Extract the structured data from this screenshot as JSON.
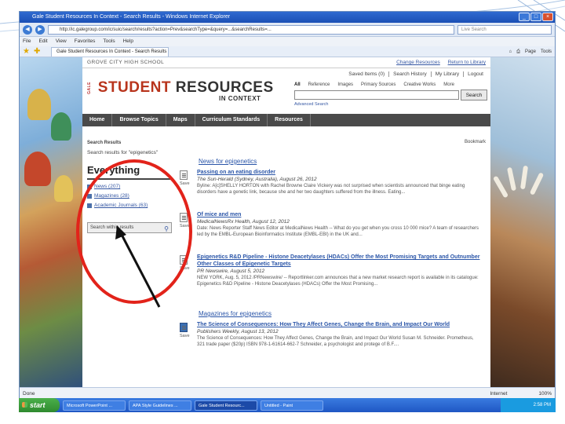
{
  "window": {
    "title": "Gale Student Resources In Context - Search Results - Windows Internet Explorer",
    "url": "http://ic.galegroup.com/ic/suic/search/results?action=Prev&searchType=&query=...&searchResults=...",
    "search_placeholder": "Live Search",
    "menu": [
      "File",
      "Edit",
      "View",
      "Favorites",
      "Tools",
      "Help"
    ],
    "tab_title": "Gale Student Resources In Context - Search Results",
    "tools": [
      "Page",
      "Tools"
    ]
  },
  "site": {
    "school": "GROVE CITY HIGH SCHOOL",
    "links": [
      "Change Resources",
      "Return to Library"
    ],
    "top_links": [
      "Saved Items (0)",
      "Search History",
      "My Library",
      "Logout"
    ],
    "logo_gale": "GALE",
    "logo_student": "STUDENT",
    "logo_resources": "RESOURCES",
    "logo_context": "IN CONTEXT",
    "search_tabs": [
      "All",
      "Reference",
      "Images",
      "Primary Sources",
      "Creative Works",
      "More"
    ],
    "search_button": "Search",
    "advanced": "Advanced Search",
    "nav": [
      "Home",
      "Browse Topics",
      "Maps",
      "Curriculum Standards",
      "Resources"
    ]
  },
  "results": {
    "breadcrumb": "Search Results",
    "bookmark": "Bookmark",
    "results_for": "Search results for \"epigenetics\"",
    "facets": {
      "heading": "Everything",
      "items": [
        "News (207)",
        "Magazines (28)",
        "Academic Journals (63)"
      ],
      "within": "Search within results"
    },
    "news_heading": "News for epigenetics",
    "magazines_heading": "Magazines for epigenetics",
    "entries": [
      {
        "title": "Passing on an eating disorder",
        "source": "The Sun-Herald (Sydney, Australia), August 26, 2012",
        "snippet": "Byline: A[c]SHELLY HORTON with Rachel Browne Claire Vickery was not surprised when scientists announced that binge eating disorders have a genetic link, because she and her two daughters suffered from the illness. Eating..."
      },
      {
        "title": "Of mice and men",
        "source": "MedicalNewsRx Health, August 12, 2012",
        "snippet": "Date: News Reporter Staff News Editor at MedicalNews Health -- What do you get when you cross 10 000 mice? A team of researchers led by the EMBL-European Bioinformatics Institute (EMBL-EBI) in the UK and..."
      },
      {
        "title": "Epigenetics R&D Pipeline - Histone Deacetylases (HDACs) Offer the Most Promising Targets and Outnumber Other Classes of Epigenetic Targets",
        "source": "PR Newswire, August 5, 2012",
        "snippet": "NEW YORK, Aug. 5, 2012 /PRNewswire/ -- Reportlinker.com announces that a new market research report is available in its catalogue: Epigenetics R&D Pipeline - Histone Deacetylases (HDACs) Offer the Most Promising..."
      },
      {
        "title": "The Science of Consequences: How They Affect Genes, Change the Brain, and Impact Our World",
        "source": "Publishers Weekly, August 13, 2012",
        "snippet": "The Science of Consequences: How They Affect Genes, Change the Brain, and Impact Our World Susan M. Schneider. Prometheus, 321 trade paper ($20p) ISBN 978-1-61614-662-7 Schneider, a psychologist and protege of B.F...."
      }
    ],
    "save_label": "Save"
  },
  "status": {
    "left": "Done",
    "zone": "Internet",
    "zoom": "100%"
  },
  "taskbar": {
    "start": "start",
    "tasks": [
      "Microsoft PowerPoint ...",
      "APA Style Guidelines ...",
      "Gale Student Resourc...",
      "Untitled - Paint"
    ],
    "clock": "2:58 PM"
  },
  "colors": {
    "brand_red": "#b8341c",
    "link_blue": "#2a55a8",
    "annotation_red": "#e2231a",
    "nav_dark": "#4a4a4a"
  }
}
